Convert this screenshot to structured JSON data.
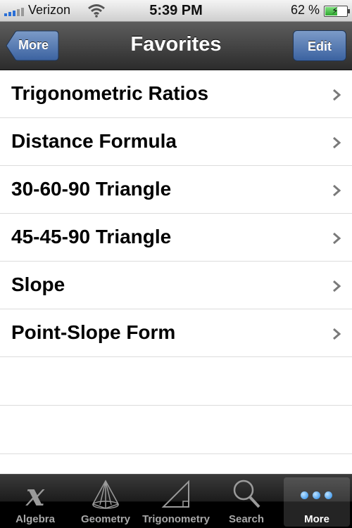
{
  "status_bar": {
    "carrier": "Verizon",
    "time": "5:39 PM",
    "battery_percent": "62 %",
    "battery_level": 0.62
  },
  "nav_bar": {
    "back_label": "More",
    "title": "Favorites",
    "edit_label": "Edit"
  },
  "list": {
    "items": [
      {
        "label": "Trigonometric Ratios"
      },
      {
        "label": "Distance Formula"
      },
      {
        "label": "30-60-90 Triangle"
      },
      {
        "label": "45-45-90 Triangle"
      },
      {
        "label": "Slope"
      },
      {
        "label": "Point-Slope Form"
      }
    ]
  },
  "tab_bar": {
    "tabs": [
      {
        "label": "Algebra",
        "icon": "x-variable-icon"
      },
      {
        "label": "Geometry",
        "icon": "pyramid-icon"
      },
      {
        "label": "Trigonometry",
        "icon": "right-triangle-icon"
      },
      {
        "label": "Search",
        "icon": "magnifier-icon"
      },
      {
        "label": "More",
        "icon": "three-dots-icon",
        "selected": true
      }
    ]
  },
  "colors": {
    "nav_bar": "#3a3a3a",
    "edit_button": "#4a6ea8",
    "accent_dots": "#1f86e8",
    "tab_bar": "#1a1a1a"
  }
}
